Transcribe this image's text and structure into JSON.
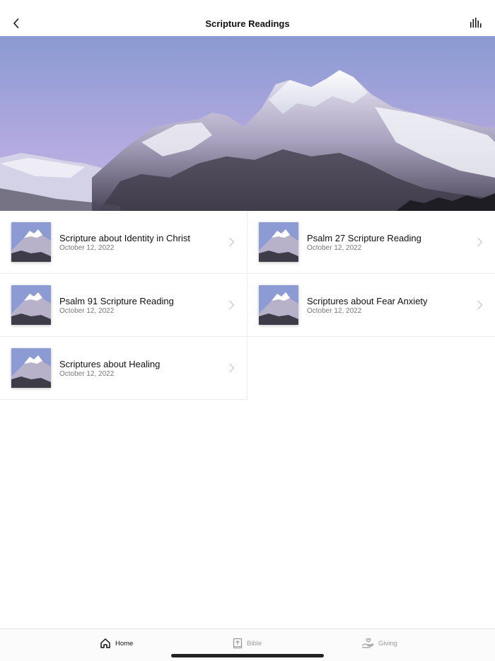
{
  "header": {
    "title": "Scripture Readings",
    "back_icon": "chevron-left-icon",
    "audio_icon": "audio-bars-icon"
  },
  "hero": {
    "image": "snowy-mountain-range-photo",
    "sky_color_top": "#8e9cd4",
    "sky_color_bottom": "#b5abe0"
  },
  "readings": [
    {
      "title": "Scripture about Identity in Christ",
      "date": "October 12, 2022"
    },
    {
      "title": "Psalm 27 Scripture Reading",
      "date": "October 12, 2022"
    },
    {
      "title": "Psalm 91 Scripture Reading",
      "date": "October 12, 2022"
    },
    {
      "title": "Scriptures about Fear Anxiety",
      "date": "October 12, 2022"
    },
    {
      "title": "Scriptures about Healing",
      "date": "October 12, 2022"
    }
  ],
  "tabs": [
    {
      "label": "Home",
      "icon": "home-icon",
      "active": true
    },
    {
      "label": "Bible",
      "icon": "bible-icon",
      "active": false
    },
    {
      "label": "Giving",
      "icon": "giving-hand-icon",
      "active": false
    }
  ]
}
